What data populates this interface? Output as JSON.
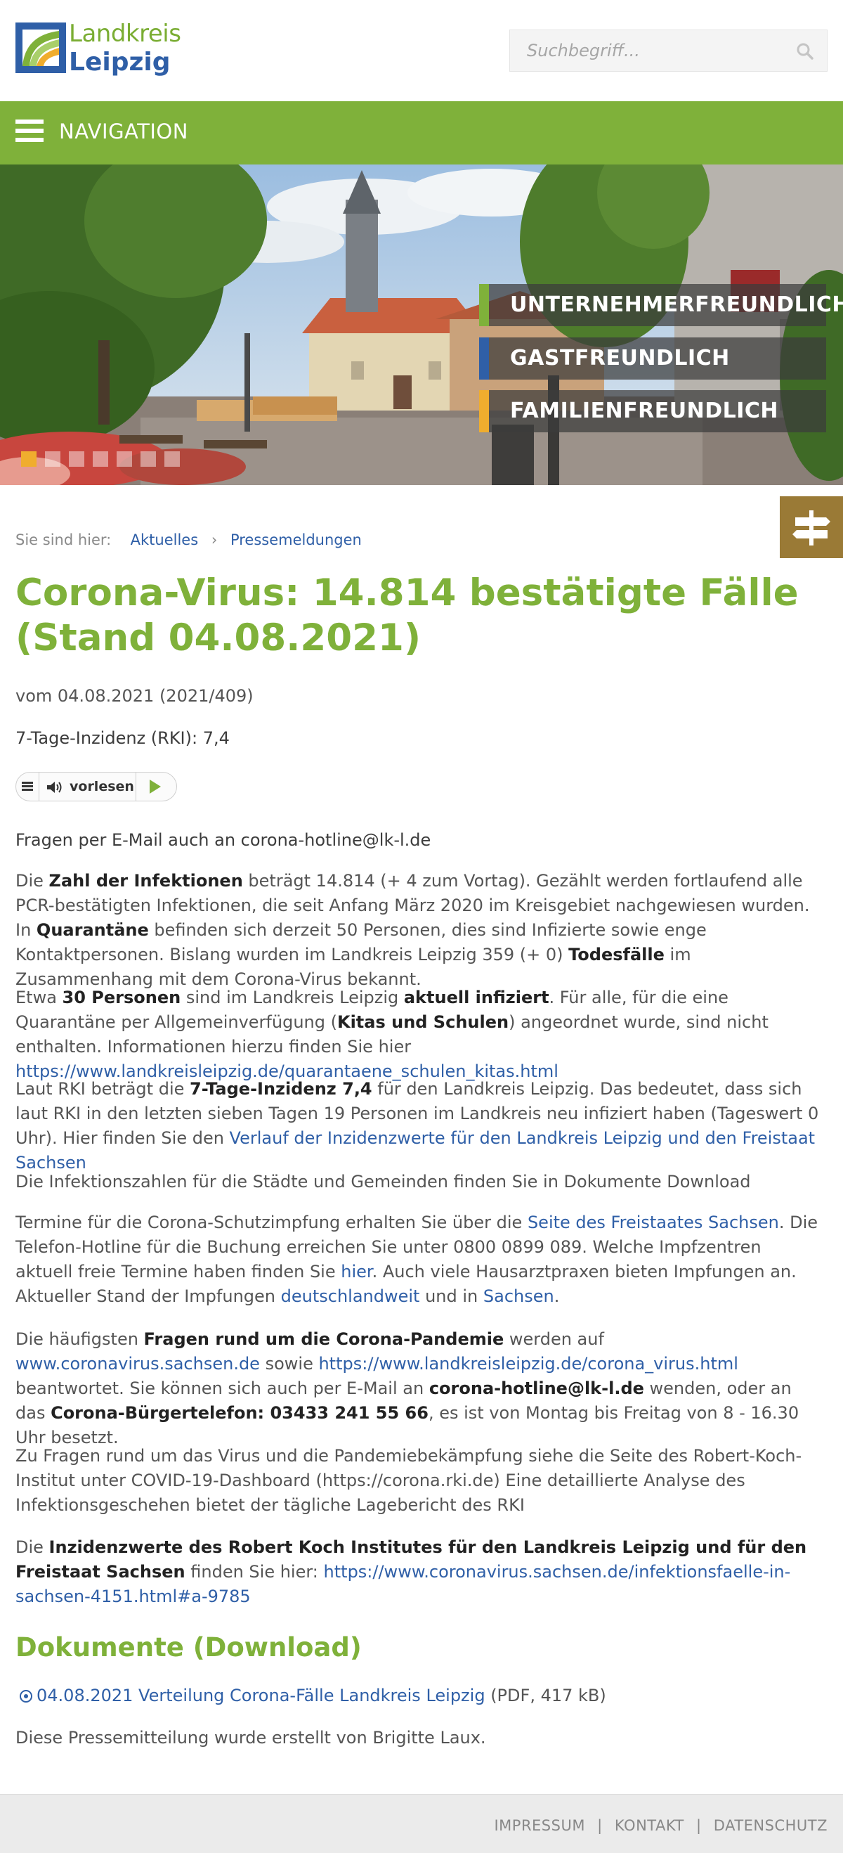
{
  "header": {
    "logo_line1": "Landkreis",
    "logo_line2": "Leipzig",
    "search_placeholder": "Suchbegriff..."
  },
  "nav": {
    "label": "NAVIGATION"
  },
  "hero": {
    "claims": [
      {
        "label": "UNTERNEHMERFREUNDLICH",
        "color": "#7fb13a"
      },
      {
        "label": "GASTFREUNDLICH",
        "color": "#2f5fa7"
      },
      {
        "label": "FAMILIENFREUNDLICH",
        "color": "#f0ad2e"
      }
    ],
    "slide_count": 7,
    "active_slide": 1
  },
  "breadcrumb": {
    "prefix": "Sie sind hier:",
    "items": [
      "Aktuelles",
      "Pressemeldungen"
    ],
    "separator": "›"
  },
  "article": {
    "title": "Corona-Virus: 14.814 bestätigte Fälle (Stand 04.08.2021)",
    "meta": "vom 04.08.2021 (2021/409)",
    "inzidenz": "7-Tage-Inzidenz (RKI): 7,4",
    "readspeaker_label": "vorlesen",
    "hotline": "Fragen per E-Mail auch an corona-hotline@lk-l.de",
    "para1": {
      "t1": "Die ",
      "b1": "Zahl der Infektionen",
      "t2": " beträgt 14.814 (+ 4 zum Vortag). Gezählt werden fortlaufend alle PCR-bestätigten Infektionen, die seit Anfang März 2020 im Kreisgebiet nachgewiesen wurden. In ",
      "b2": "Quarantäne",
      "t3": " befinden sich derzeit 50 Personen, dies sind Infizierte sowie enge Kontaktpersonen. Bislang wurden im Landkreis Leipzig 359 (+ 0) ",
      "b3": "Todesfälle",
      "t4": " im Zusammenhang mit dem Corona-Virus bekannt."
    },
    "para2": {
      "t1": "Etwa ",
      "b1": "30 Personen",
      "t2": " sind im Landkreis Leipzig ",
      "b2": "aktuell infiziert",
      "t3": ". Für alle, für die eine Quarantäne per Allgemeinverfügung (",
      "b3": "Kitas und Schulen",
      "t4": ") angeordnet wurde, sind nicht enthalten. Informationen hierzu finden Sie hier ",
      "link": "https://www.landkreisleipzig.de/quarantaene_schulen_kitas.html"
    },
    "para3": {
      "t1": "Laut RKI beträgt die ",
      "b1": "7-Tage-Inzidenz 7,4",
      "t2": " für den Landkreis Leipzig. Das bedeutet, dass sich laut RKI in den letzten sieben Tagen 19 Personen im Landkreis neu infiziert haben (Tageswert 0 Uhr). Hier finden Sie den ",
      "link": "Verlauf der Inzidenzwerte für den Landkreis Leipzig und den Freistaat Sachsen"
    },
    "para4": "Die Infektionszahlen für die Städte und Gemeinden finden Sie in Dokumente Download",
    "para5": {
      "t1": "Termine für die Corona-Schutzimpfung erhalten Sie über die ",
      "link1": "Seite des Freistaates Sachsen",
      "t2": ". Die Telefon-Hotline für die Buchung erreichen Sie unter 0800 0899 089. Welche Impfzentren aktuell freie Termine haben finden Sie ",
      "link2": "hier",
      "t3": ".  Auch viele Hausarztpraxen bieten Impfungen an. Aktueller Stand der Impfungen ",
      "link3": "deutschlandweit",
      "t4": " und in ",
      "link4": "Sachsen",
      "t5": "."
    },
    "para6": {
      "t1": "Die häufigsten ",
      "b1": "Fragen rund um die Corona-Pandemie",
      "t2": " werden auf ",
      "link1": "www.coronavirus.sachsen.de",
      "t3": " sowie ",
      "link2": "https://www.landkreisleipzig.de/corona_virus.html",
      "t4": " beantwortet. Sie können sich auch per E-Mail an ",
      "b2": "corona-hotline@lk-l.de",
      "t5": " wenden, oder an das ",
      "b3": "Corona-Bürgertelefon: 03433 241 55 66",
      "t6": ", es ist von Montag bis Freitag von 8 - 16.30 Uhr besetzt."
    },
    "para7": "Zu Fragen rund um das Virus und die Pandemiebekämpfung siehe die Seite des Robert-Koch-Institut unter COVID-19-Dashboard (https://corona.rki.de)  Eine detaillierte Analyse des Infektionsgeschehen bietet der tägliche Lagebericht des RKI",
    "para8": {
      "t1": "Die ",
      "b1": "Inzidenzwerte des Robert Koch Institutes für den Landkreis Leipzig und für den Freistaat Sachsen",
      "t2": " finden Sie hier: ",
      "link": "https://www.coronavirus.sachsen.de/infektionsfaelle-in-sachsen-4151.html#a-9785"
    },
    "docs_heading": "Dokumente (Download)",
    "doc_link": "04.08.2021 Verteilung Corona-Fälle Landkreis Leipzig",
    "doc_meta": " (PDF, 417 kB)",
    "author": "Diese Pressemitteilung wurde erstellt von Brigitte Laux."
  },
  "footer": {
    "links": [
      "IMPRESSUM",
      "KONTAKT",
      "DATENSCHUTZ"
    ],
    "separator": "|"
  }
}
